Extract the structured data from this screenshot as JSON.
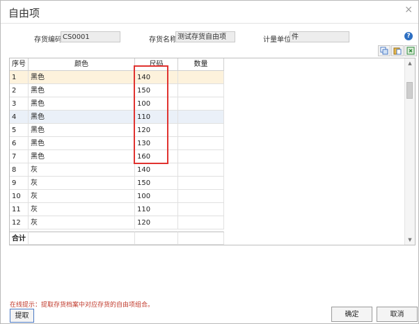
{
  "dialog": {
    "title": "自由项",
    "close_glyph": "×"
  },
  "fields": {
    "inventory_code_label": "存货编码",
    "inventory_code_value": "CS0001",
    "inventory_name_label": "存货名称",
    "inventory_name_value": "测试存货自由项",
    "unit_label": "计量单位",
    "unit_value": "件"
  },
  "toolbar": {
    "help_glyph": "?"
  },
  "grid": {
    "columns": [
      "序号",
      "颜色",
      "尺码",
      "数量"
    ],
    "rows": [
      {
        "idx": "1",
        "color": "黑色",
        "size": "140",
        "qty": ""
      },
      {
        "idx": "2",
        "color": "黑色",
        "size": "150",
        "qty": ""
      },
      {
        "idx": "3",
        "color": "黑色",
        "size": "100",
        "qty": ""
      },
      {
        "idx": "4",
        "color": "黑色",
        "size": "110",
        "qty": ""
      },
      {
        "idx": "5",
        "color": "黑色",
        "size": "120",
        "qty": ""
      },
      {
        "idx": "6",
        "color": "黑色",
        "size": "130",
        "qty": ""
      },
      {
        "idx": "7",
        "color": "黑色",
        "size": "160",
        "qty": ""
      },
      {
        "idx": "8",
        "color": "灰",
        "size": "140",
        "qty": ""
      },
      {
        "idx": "9",
        "color": "灰",
        "size": "150",
        "qty": ""
      },
      {
        "idx": "10",
        "color": "灰",
        "size": "100",
        "qty": ""
      },
      {
        "idx": "11",
        "color": "灰",
        "size": "110",
        "qty": ""
      },
      {
        "idx": "12",
        "color": "灰",
        "size": "120",
        "qty": ""
      }
    ],
    "total_label": "合计",
    "selected_row": 1,
    "highlighted_row": 4
  },
  "footer": {
    "hint": "在线提示：提取存货档案中对应存货的自由项组合。",
    "fetch_label": "提取",
    "ok_label": "确定",
    "cancel_label": "取消"
  },
  "colors": {
    "highlight_box": "#e0322f",
    "hint_text": "#c0392b",
    "selected_row_bg": "#fdf2dc"
  }
}
